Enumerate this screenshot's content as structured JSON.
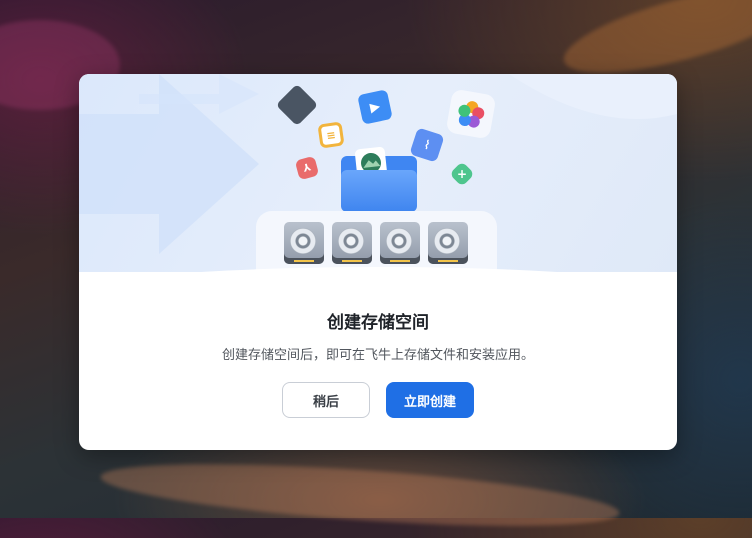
{
  "dialog": {
    "title": "创建存储空间",
    "description": "创建存储空间后，即可在飞牛上存储文件和安装应用。",
    "later_button": "稍后",
    "create_button": "立即创建"
  },
  "hero": {
    "icons": [
      "video-icon",
      "notes-icon",
      "photos-icon",
      "pdf-icon",
      "chart-icon",
      "image-icon",
      "add-icon",
      "dark-app-icon"
    ],
    "drives": [
      "hard-drive-icon",
      "hard-drive-icon",
      "hard-drive-icon",
      "hard-drive-icon"
    ]
  },
  "colors": {
    "accent": "#1f6fe5",
    "hero_background": "#dbe8fb"
  }
}
